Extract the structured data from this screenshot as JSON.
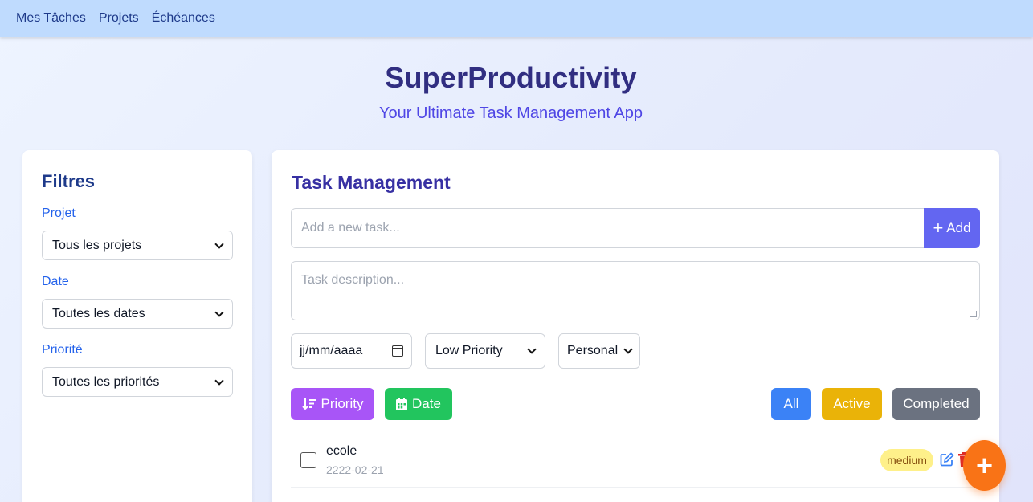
{
  "nav": {
    "items": [
      "Mes Tâches",
      "Projets",
      "Échéances"
    ]
  },
  "header": {
    "title": "SuperProductivity",
    "subtitle": "Your Ultimate Task Management App"
  },
  "sidebar": {
    "title": "Filtres",
    "filters": [
      {
        "label": "Projet",
        "value": "Tous les projets"
      },
      {
        "label": "Date",
        "value": "Toutes les dates"
      },
      {
        "label": "Priorité",
        "value": "Toutes les priorités"
      }
    ]
  },
  "main": {
    "title": "Task Management",
    "task_placeholder": "Add a new task...",
    "add_label": "Add",
    "description_placeholder": "Task description...",
    "date_placeholder": "jj/mm/aaaa",
    "priority_value": "Low Priority",
    "category_value": "Personal",
    "sort_priority_label": "Priority",
    "sort_date_label": "Date",
    "filter_all": "All",
    "filter_active": "Active",
    "filter_completed": "Completed"
  },
  "tasks": [
    {
      "title": "ecole",
      "date": "2222-02-21",
      "priority": "medium",
      "completed": false
    }
  ],
  "fab_label": "+",
  "colors": {
    "nav_bg": "#bfdbfe",
    "accent": "#6366f1",
    "priority_button": "#a855f7",
    "date_button": "#22c55e",
    "all_button": "#3b82f6",
    "active_button": "#eab308",
    "completed_button": "#6b7280",
    "fab": "#f97316",
    "badge_medium": "#fef08a"
  }
}
